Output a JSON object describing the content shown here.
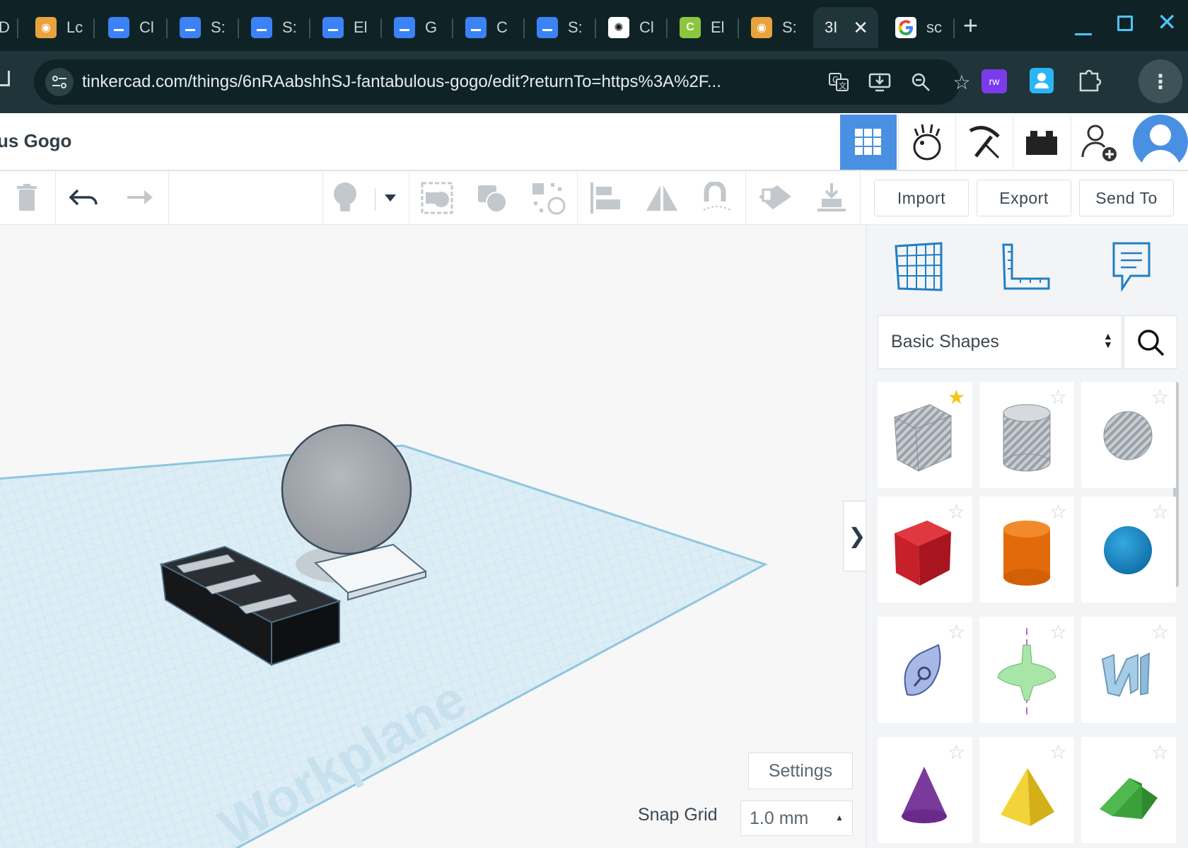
{
  "browser": {
    "tabs": [
      {
        "label": "D",
        "icon": "generic-icon"
      },
      {
        "label": "Lc",
        "icon": "tinkercad-bot-icon"
      },
      {
        "label": "Cl",
        "icon": "google-docs-icon"
      },
      {
        "label": "S:",
        "icon": "google-docs-icon"
      },
      {
        "label": "S:",
        "icon": "google-docs-icon"
      },
      {
        "label": "El",
        "icon": "google-docs-icon"
      },
      {
        "label": "G",
        "icon": "google-docs-icon"
      },
      {
        "label": "C",
        "icon": "google-docs-icon"
      },
      {
        "label": "S:",
        "icon": "google-docs-icon"
      },
      {
        "label": "Cl",
        "icon": "chatgpt-icon"
      },
      {
        "label": "El",
        "icon": "c-app-icon"
      },
      {
        "label": "S:",
        "icon": "tinkercad-bot-icon"
      },
      {
        "label": "3I",
        "icon": "none",
        "active": true
      },
      {
        "label": "sc",
        "icon": "google-icon"
      }
    ],
    "url": "tinkercad.com/things/6nRAabshhSJ-fantabulous-gogo/edit?returnTo=https%3A%2F...",
    "toolbar_icons": [
      "translate-icon",
      "install-app-icon",
      "zoom-icon",
      "bookmark-star-icon"
    ],
    "extensions": [
      "rw-extension-icon",
      "person-pin-extension-icon",
      "puzzle-extensions-icon"
    ]
  },
  "app": {
    "title": "us Gogo",
    "header_icons": [
      "grid-3d-view-icon",
      "codeblocks-icon",
      "minecraft-pickaxe-icon",
      "lego-brick-icon",
      "add-user-icon",
      "profile-avatar-icon"
    ],
    "toolbar": {
      "import_label": "Import",
      "export_label": "Export",
      "send_to_label": "Send To"
    },
    "panel": {
      "tools": [
        "workplane-grid-icon",
        "ruler-icon",
        "notes-icon"
      ],
      "category": "Basic Shapes",
      "shapes": [
        {
          "name": "Box (Hole)",
          "starred": true
        },
        {
          "name": "Cylinder (Hole)",
          "starred": false
        },
        {
          "name": "Sphere (Hole)",
          "starred": false
        },
        {
          "name": "Box",
          "starred": false
        },
        {
          "name": "Cylinder",
          "starred": false
        },
        {
          "name": "Sphere",
          "starred": false
        },
        {
          "name": "Scribble",
          "starred": false
        },
        {
          "name": "Graph",
          "starred": false
        },
        {
          "name": "Text",
          "starred": false
        },
        {
          "name": "Cone",
          "starred": false
        },
        {
          "name": "Pyramid",
          "starred": false
        },
        {
          "name": "Roof",
          "starred": false
        }
      ]
    },
    "viewport": {
      "workplane_label": "Workplane",
      "settings_label": "Settings",
      "snap_grid_label": "Snap Grid",
      "snap_grid_value": "1.0 mm"
    },
    "colors": {
      "accent": "#4a90e2",
      "chrome_dark": "#0f2327",
      "chrome_mid": "#1f3539"
    }
  }
}
